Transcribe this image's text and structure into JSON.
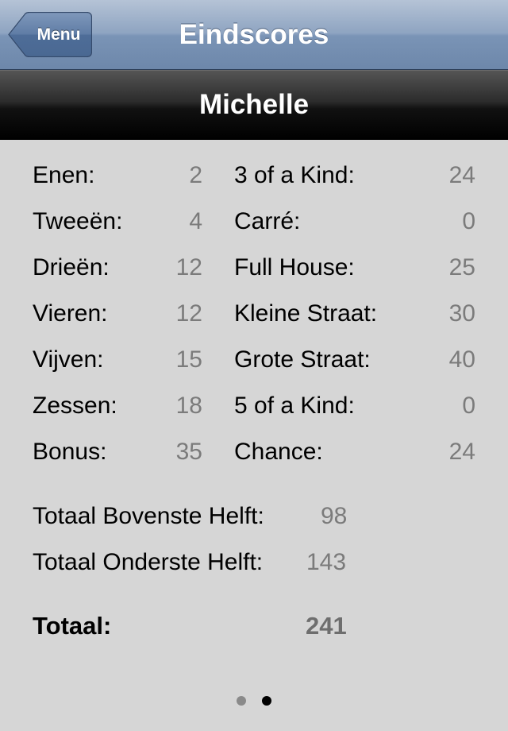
{
  "navbar": {
    "back_label": "Menu",
    "title": "Eindscores"
  },
  "player": {
    "name": "Michelle"
  },
  "upper": [
    {
      "label": "Enen:",
      "value": "2"
    },
    {
      "label": "Tweeën:",
      "value": "4"
    },
    {
      "label": "Drieën:",
      "value": "12"
    },
    {
      "label": "Vieren:",
      "value": "12"
    },
    {
      "label": "Vijven:",
      "value": "15"
    },
    {
      "label": "Zessen:",
      "value": "18"
    },
    {
      "label": "Bonus:",
      "value": "35"
    }
  ],
  "lower": [
    {
      "label": "3 of a Kind:",
      "value": "24"
    },
    {
      "label": "Carré:",
      "value": "0"
    },
    {
      "label": "Full House:",
      "value": "25"
    },
    {
      "label": "Kleine Straat:",
      "value": "30"
    },
    {
      "label": "Grote Straat:",
      "value": "40"
    },
    {
      "label": "5 of a Kind:",
      "value": "0"
    },
    {
      "label": "Chance:",
      "value": "24"
    }
  ],
  "totals": {
    "upper_label": "Totaal Bovenste Helft:",
    "upper_value": "98",
    "lower_label": "Totaal Onderste Helft:",
    "lower_value": "143",
    "grand_label": "Totaal:",
    "grand_value": "241"
  },
  "pagination": {
    "current_page": 2,
    "page_count": 2
  },
  "colors": {
    "navbar": "#8ea4c1",
    "player_bar": "#111111",
    "background": "#d6d6d6",
    "value_text": "#7b7b7b"
  }
}
